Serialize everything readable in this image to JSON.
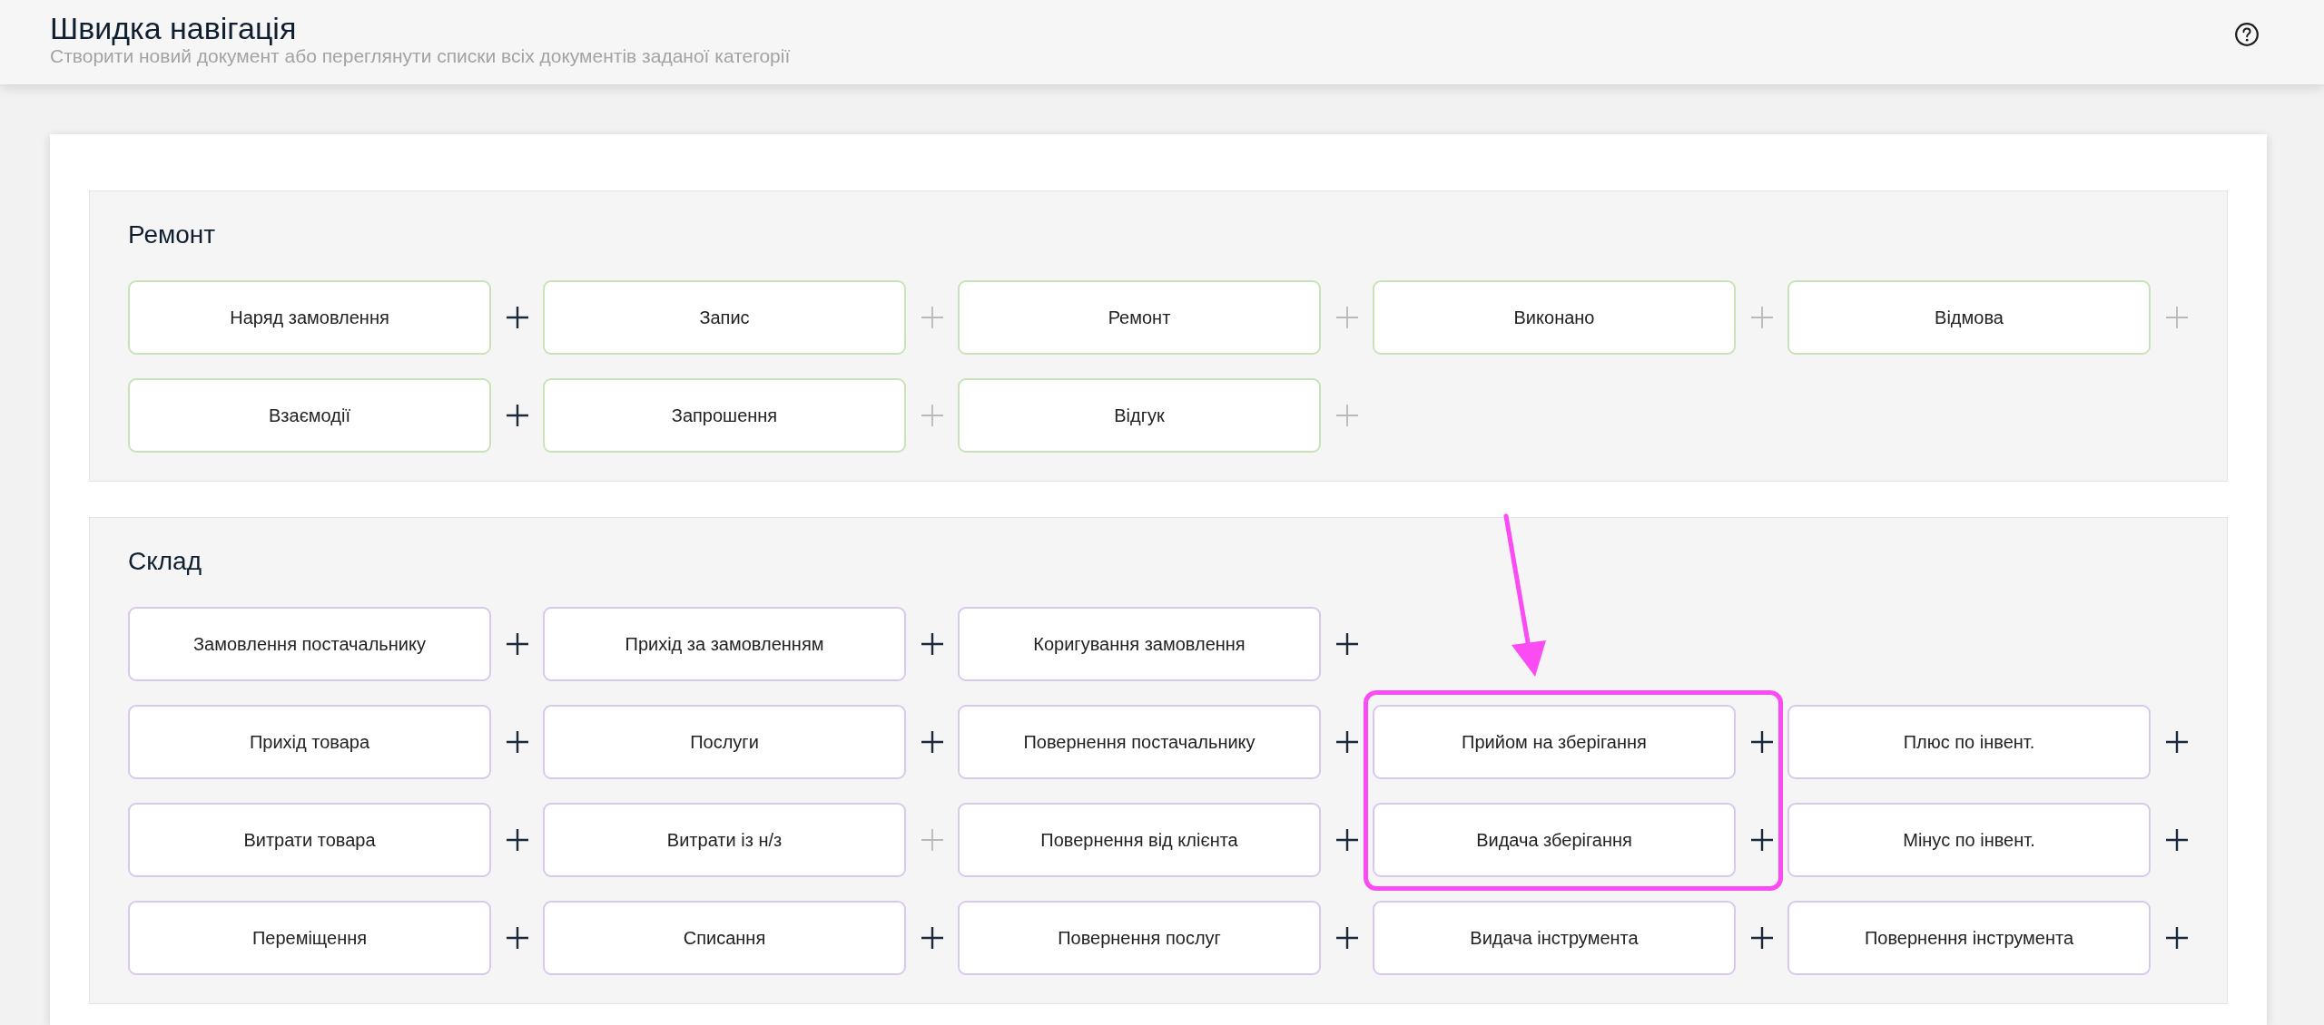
{
  "header": {
    "title": "Швидка навігація",
    "subtitle": "Створити новий документ або переглянути списки всіх документів заданої категорії"
  },
  "sections": [
    {
      "title": "Ремонт",
      "color": "#c8e3b7",
      "rows": [
        [
          {
            "label": "Наряд замовлення",
            "create_enabled": true,
            "highlighted": false
          },
          {
            "label": "Запис",
            "create_enabled": false,
            "highlighted": false
          },
          {
            "label": "Ремонт",
            "create_enabled": false,
            "highlighted": false
          },
          {
            "label": "Виконано",
            "create_enabled": false,
            "highlighted": false
          },
          {
            "label": "Відмова",
            "create_enabled": false,
            "highlighted": false
          }
        ],
        [
          {
            "label": "Взаємодії",
            "create_enabled": true,
            "highlighted": false
          },
          {
            "label": "Запрошення",
            "create_enabled": false,
            "highlighted": false
          },
          {
            "label": "Відгук",
            "create_enabled": false,
            "highlighted": false
          }
        ]
      ]
    },
    {
      "title": "Склад",
      "color": "#d7c8ec",
      "rows": [
        [
          {
            "label": "Замовлення постачальнику",
            "create_enabled": true,
            "highlighted": false
          },
          {
            "label": "Прихід за замовленням",
            "create_enabled": true,
            "highlighted": false
          },
          {
            "label": "Коригування замовлення",
            "create_enabled": true,
            "highlighted": false
          }
        ],
        [
          {
            "label": "Прихід товара",
            "create_enabled": true,
            "highlighted": false
          },
          {
            "label": "Послуги",
            "create_enabled": true,
            "highlighted": false
          },
          {
            "label": "Повернення постачальнику",
            "create_enabled": true,
            "highlighted": false
          },
          {
            "label": "Прийом на зберігання",
            "create_enabled": true,
            "highlighted": true
          },
          {
            "label": "Плюс по інвент.",
            "create_enabled": true,
            "highlighted": false
          }
        ],
        [
          {
            "label": "Витрати товара",
            "create_enabled": true,
            "highlighted": false
          },
          {
            "label": "Витрати із н/з",
            "create_enabled": false,
            "highlighted": false
          },
          {
            "label": "Повернення від клієнта",
            "create_enabled": true,
            "highlighted": false
          },
          {
            "label": "Видача зберігання",
            "create_enabled": true,
            "highlighted": true
          },
          {
            "label": "Мінус по інвент.",
            "create_enabled": true,
            "highlighted": false
          }
        ],
        [
          {
            "label": "Переміщення",
            "create_enabled": true,
            "highlighted": false
          },
          {
            "label": "Списання",
            "create_enabled": true,
            "highlighted": false
          },
          {
            "label": "Повернення послуг",
            "create_enabled": true,
            "highlighted": false
          },
          {
            "label": "Видача інструмента",
            "create_enabled": true,
            "highlighted": false
          },
          {
            "label": "Повернення інструмента",
            "create_enabled": true,
            "highlighted": false
          }
        ]
      ]
    }
  ]
}
